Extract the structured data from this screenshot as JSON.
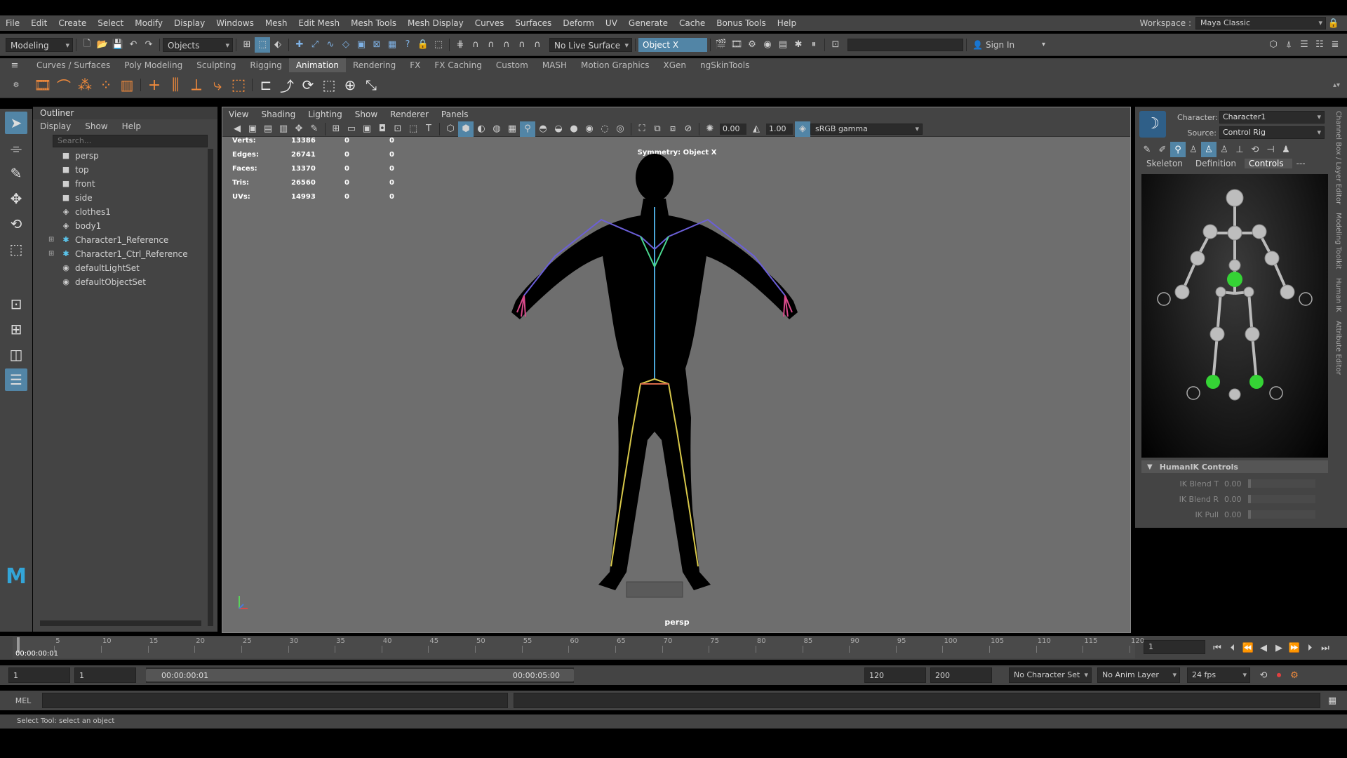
{
  "menubar": {
    "items": [
      "File",
      "Edit",
      "Create",
      "Select",
      "Modify",
      "Display",
      "Windows",
      "Mesh",
      "Edit Mesh",
      "Mesh Tools",
      "Mesh Display",
      "Curves",
      "Surfaces",
      "Deform",
      "UV",
      "Generate",
      "Cache",
      "Bonus Tools",
      "Help"
    ],
    "workspace_label": "Workspace :",
    "workspace_value": "Maya Classic"
  },
  "statusline": {
    "menuset": "Modeling",
    "selection_mode": "Objects",
    "live_surface": "No Live Surface",
    "symmetry": "Object X",
    "sign_in": "Sign In"
  },
  "shelf": {
    "tabs": [
      "Curves / Surfaces",
      "Poly Modeling",
      "Sculpting",
      "Rigging",
      "Animation",
      "Rendering",
      "FX",
      "FX Caching",
      "Custom",
      "MASH",
      "Motion Graphics",
      "XGen",
      "ngSkinTools"
    ],
    "active_tab": "Animation"
  },
  "outliner": {
    "title": "Outliner",
    "menu": [
      "Display",
      "Show",
      "Help"
    ],
    "search_placeholder": "Search...",
    "items": [
      {
        "label": "persp",
        "icon": "camera-icon",
        "expandable": false
      },
      {
        "label": "top",
        "icon": "camera-icon",
        "expandable": false
      },
      {
        "label": "front",
        "icon": "camera-icon",
        "expandable": false
      },
      {
        "label": "side",
        "icon": "camera-icon",
        "expandable": false
      },
      {
        "label": "clothes1",
        "icon": "mesh-icon",
        "expandable": false
      },
      {
        "label": "body1",
        "icon": "mesh-icon",
        "expandable": false
      },
      {
        "label": "Character1_Reference",
        "icon": "joint-icon",
        "expandable": true
      },
      {
        "label": "Character1_Ctrl_Reference",
        "icon": "joint-icon",
        "expandable": true
      },
      {
        "label": "defaultLightSet",
        "icon": "set-icon",
        "expandable": false
      },
      {
        "label": "defaultObjectSet",
        "icon": "set-icon",
        "expandable": false
      }
    ]
  },
  "viewport": {
    "menu": [
      "View",
      "Shading",
      "Lighting",
      "Show",
      "Renderer",
      "Panels"
    ],
    "exposure": "0.00",
    "gamma": "1.00",
    "color_space": "sRGB gamma",
    "hud": [
      {
        "label": "Verts:",
        "v1": "13386",
        "v2": "0",
        "v3": "0"
      },
      {
        "label": "Edges:",
        "v1": "26741",
        "v2": "0",
        "v3": "0"
      },
      {
        "label": "Faces:",
        "v1": "13370",
        "v2": "0",
        "v3": "0"
      },
      {
        "label": "Tris:",
        "v1": "26560",
        "v2": "0",
        "v3": "0"
      },
      {
        "label": "UVs:",
        "v1": "14993",
        "v2": "0",
        "v3": "0"
      }
    ],
    "symmetry_label": "Symmetry: Object X",
    "camera": "persp"
  },
  "humanik": {
    "character_label": "Character:",
    "character_value": "Character1",
    "source_label": "Source:",
    "source_value": "Control Rig",
    "tabs": [
      "Skeleton",
      "Definition",
      "Controls",
      "---"
    ],
    "active_tab": "Controls",
    "section_title": "HumanIK Controls",
    "controls": [
      {
        "label": "IK Blend T",
        "value": "0.00"
      },
      {
        "label": "IK Blend R",
        "value": "0.00"
      },
      {
        "label": "IK Pull",
        "value": "0.00"
      }
    ]
  },
  "sidebar_tabs": [
    "Channel Box / Layer Editor",
    "Modeling Toolkit",
    "Human IK",
    "Attribute Editor"
  ],
  "timeline": {
    "ticks": [
      "5",
      "10",
      "15",
      "20",
      "25",
      "30",
      "35",
      "40",
      "45",
      "50",
      "55",
      "60",
      "65",
      "70",
      "75",
      "80",
      "85",
      "90",
      "95",
      "100",
      "105",
      "110",
      "115",
      "120"
    ],
    "current_time": "00:00:00:01",
    "current_frame": "1"
  },
  "range": {
    "start_field": "1",
    "playback_start": "1",
    "range_start_label": "00:00:00:01",
    "range_end_label": "00:00:05:00",
    "playback_end": "120",
    "end_field": "200",
    "character_set": "No Character Set",
    "anim_layer": "No Anim Layer",
    "fps": "24 fps"
  },
  "cmdline": {
    "label": "MEL"
  },
  "helpline": {
    "text": "Select Tool: select an object"
  },
  "colors": {
    "accent": "#5285a6",
    "hik_green": "#35d335",
    "panel": "#444444"
  }
}
